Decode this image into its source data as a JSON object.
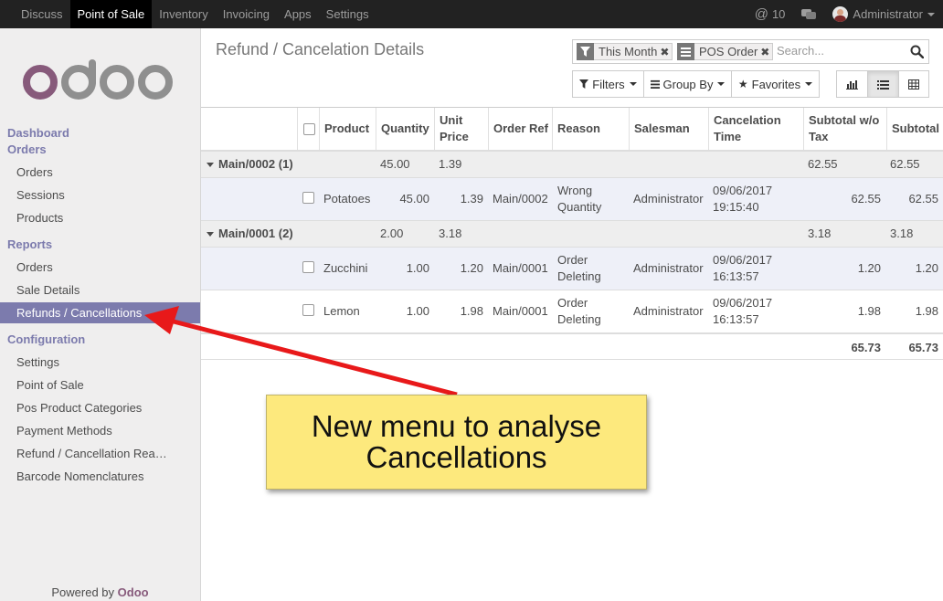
{
  "topbar": {
    "menu": [
      "Discuss",
      "Point of Sale",
      "Inventory",
      "Invoicing",
      "Apps",
      "Settings"
    ],
    "active": "Point of Sale",
    "mentions_count": "10",
    "user": "Administrator"
  },
  "sidebar": {
    "logo_text": "odoo",
    "dashboard": "Dashboard",
    "orders_section": "Orders",
    "orders_items": [
      "Orders",
      "Sessions",
      "Products"
    ],
    "reports_section": "Reports",
    "reports_items": [
      "Orders",
      "Sale Details",
      "Refunds / Cancellations"
    ],
    "config_section": "Configuration",
    "config_items": [
      "Settings",
      "Point of Sale",
      "Pos Product Categories",
      "Payment Methods",
      "Refund / Cancellation Rea…",
      "Barcode Nomenclatures"
    ],
    "powered_prefix": "Powered by",
    "powered_brand": "Odoo"
  },
  "control": {
    "title": "Refund / Cancelation Details",
    "facets": [
      "This Month",
      "POS Order"
    ],
    "search_placeholder": "Search...",
    "filters": "Filters",
    "group_by": "Group By",
    "favorites": "Favorites"
  },
  "table": {
    "columns": [
      "Product",
      "Quantity",
      "Unit Price",
      "Order Ref",
      "Reason",
      "Salesman",
      "Cancelation Time",
      "Subtotal w/o Tax",
      "Subtotal"
    ],
    "groups": [
      {
        "name": "Main/0002 (1)",
        "qty": "45.00",
        "price": "1.39",
        "subtotal_wo": "62.55",
        "subtotal": "62.55",
        "rows": [
          {
            "product": "Potatoes",
            "qty": "45.00",
            "price": "1.39",
            "ref": "Main/0002",
            "reason1": "Wrong",
            "reason2": "Quantity",
            "salesman": "Administrator",
            "date": "09/06/2017",
            "time": "19:15:40",
            "subtotal_wo": "62.55",
            "subtotal": "62.55"
          }
        ]
      },
      {
        "name": "Main/0001 (2)",
        "qty": "2.00",
        "price": "3.18",
        "subtotal_wo": "3.18",
        "subtotal": "3.18",
        "rows": [
          {
            "product": "Zucchini",
            "qty": "1.00",
            "price": "1.20",
            "ref": "Main/0001",
            "reason1": "Order",
            "reason2": "Deleting",
            "salesman": "Administrator",
            "date": "09/06/2017",
            "time": "16:13:57",
            "subtotal_wo": "1.20",
            "subtotal": "1.20"
          },
          {
            "product": "Lemon",
            "qty": "1.00",
            "price": "1.98",
            "ref": "Main/0001",
            "reason1": "Order",
            "reason2": "Deleting",
            "salesman": "Administrator",
            "date": "09/06/2017",
            "time": "16:13:57",
            "subtotal_wo": "1.98",
            "subtotal": "1.98"
          }
        ]
      }
    ],
    "totals": {
      "subtotal_wo": "65.73",
      "subtotal": "65.73"
    }
  },
  "annotation": {
    "line1": "New menu to analyse",
    "line2": "Cancellations"
  },
  "colors": {
    "brand": "#7c7bad",
    "odoo_purple": "#875a7b",
    "note_bg": "#fde97d",
    "arrow": "#e8191a"
  }
}
